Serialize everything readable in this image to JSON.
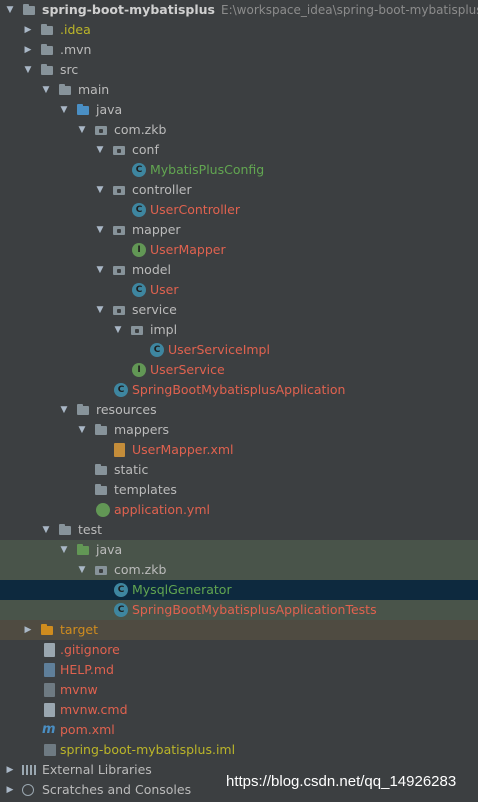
{
  "project": {
    "name": "spring-boot-mybatisplus",
    "path": "E:\\workspace_idea\\spring-boot-mybatisplus"
  },
  "nodes": [
    {
      "label": ".idea",
      "color": "#bbb529"
    },
    {
      "label": ".mvn",
      "color": "#bbbbbb"
    },
    {
      "label": "src",
      "color": "#bbbbbb"
    },
    {
      "label": "main",
      "color": "#bbbbbb"
    },
    {
      "label": "java",
      "color": "#bbbbbb"
    },
    {
      "label": "com.zkb",
      "color": "#bbbbbb"
    },
    {
      "label": "conf",
      "color": "#bbbbbb"
    },
    {
      "label": "MybatisPlusConfig",
      "color": "#62a651"
    },
    {
      "label": "controller",
      "color": "#bbbbbb"
    },
    {
      "label": "UserController",
      "color": "#e0624f"
    },
    {
      "label": "mapper",
      "color": "#bbbbbb"
    },
    {
      "label": "UserMapper",
      "color": "#e0624f"
    },
    {
      "label": "model",
      "color": "#bbbbbb"
    },
    {
      "label": "User",
      "color": "#e0624f"
    },
    {
      "label": "service",
      "color": "#bbbbbb"
    },
    {
      "label": "impl",
      "color": "#bbbbbb"
    },
    {
      "label": "UserServiceImpl",
      "color": "#e0624f"
    },
    {
      "label": "UserService",
      "color": "#e0624f"
    },
    {
      "label": "SpringBootMybatisplusApplication",
      "color": "#e0624f"
    },
    {
      "label": "resources",
      "color": "#bbbbbb"
    },
    {
      "label": "mappers",
      "color": "#bbbbbb"
    },
    {
      "label": "UserMapper.xml",
      "color": "#e0624f"
    },
    {
      "label": "static",
      "color": "#bbbbbb"
    },
    {
      "label": "templates",
      "color": "#bbbbbb"
    },
    {
      "label": "application.yml",
      "color": "#e0624f"
    },
    {
      "label": "test",
      "color": "#bbbbbb"
    },
    {
      "label": "java",
      "color": "#bbbbbb"
    },
    {
      "label": "com.zkb",
      "color": "#bbbbbb"
    },
    {
      "label": "MysqlGenerator",
      "color": "#62a651"
    },
    {
      "label": "SpringBootMybatisplusApplicationTests",
      "color": "#e0624f"
    },
    {
      "label": "target",
      "color": "#d08c1e"
    },
    {
      "label": ".gitignore",
      "color": "#e0624f"
    },
    {
      "label": "HELP.md",
      "color": "#e0624f"
    },
    {
      "label": "mvnw",
      "color": "#e0624f"
    },
    {
      "label": "mvnw.cmd",
      "color": "#e0624f"
    },
    {
      "label": "pom.xml",
      "color": "#e0624f"
    },
    {
      "label": "spring-boot-mybatisplus.iml",
      "color": "#bbb529"
    },
    {
      "label": "External Libraries",
      "color": "#bbbbbb"
    },
    {
      "label": "Scratches and Consoles",
      "color": "#bbbbbb"
    }
  ],
  "watermark": "https://blog.csdn.net/qq_14926283"
}
